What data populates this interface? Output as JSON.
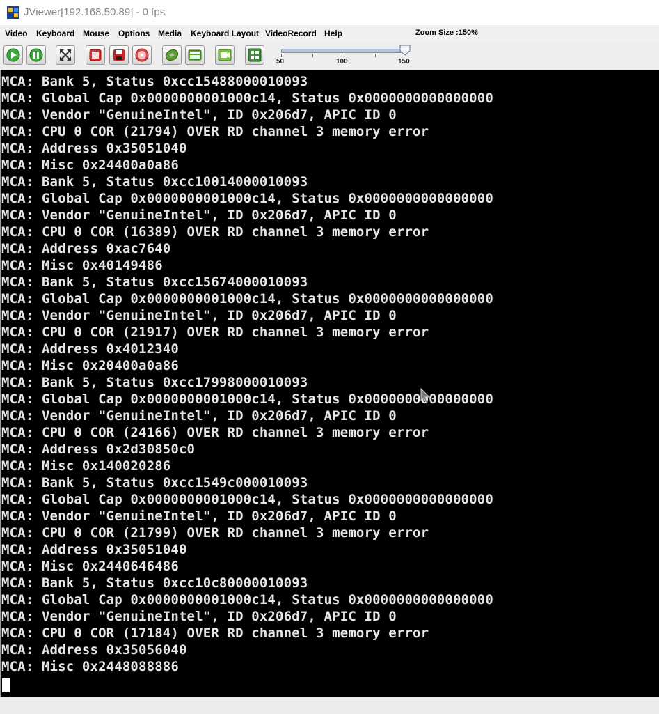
{
  "window": {
    "title": "JViewer[192.168.50.89] - 0 fps"
  },
  "menu": {
    "items": [
      {
        "label": "Video"
      },
      {
        "label": "Keyboard"
      },
      {
        "label": "Mouse"
      },
      {
        "label": "Options"
      },
      {
        "label": "Media"
      },
      {
        "label": "Keyboard Layout"
      },
      {
        "label": "VideoRecord"
      },
      {
        "label": "Help"
      }
    ],
    "zoom_label": "Zoom Size :150%"
  },
  "toolbar": {
    "buttons": [
      {
        "icon": "play-icon"
      },
      {
        "icon": "pause-icon"
      },
      {
        "icon": "fullscreen-icon"
      },
      {
        "icon": "stop-record-icon"
      },
      {
        "icon": "save-icon"
      },
      {
        "icon": "cd-icon"
      },
      {
        "icon": "mouse-icon"
      },
      {
        "icon": "keyboard-icon"
      },
      {
        "icon": "video-capture-icon"
      },
      {
        "icon": "hotkeys-icon"
      }
    ],
    "zoom_slider": {
      "min": 50,
      "max": 150,
      "value": 150,
      "labels": [
        "50",
        "100",
        "150"
      ]
    }
  },
  "console": {
    "lines": [
      "MCA: Bank 5, Status 0xcc15488000010093",
      "MCA: Global Cap 0x0000000001000c14, Status 0x0000000000000000",
      "MCA: Vendor \"GenuineIntel\", ID 0x206d7, APIC ID 0",
      "MCA: CPU 0 COR (21794) OVER RD channel 3 memory error",
      "MCA: Address 0x35051040",
      "MCA: Misc 0x24400a0a86",
      "MCA: Bank 5, Status 0xcc10014000010093",
      "MCA: Global Cap 0x0000000001000c14, Status 0x0000000000000000",
      "MCA: Vendor \"GenuineIntel\", ID 0x206d7, APIC ID 0",
      "MCA: CPU 0 COR (16389) OVER RD channel 3 memory error",
      "MCA: Address 0xac7640",
      "MCA: Misc 0x40149486",
      "MCA: Bank 5, Status 0xcc15674000010093",
      "MCA: Global Cap 0x0000000001000c14, Status 0x0000000000000000",
      "MCA: Vendor \"GenuineIntel\", ID 0x206d7, APIC ID 0",
      "MCA: CPU 0 COR (21917) OVER RD channel 3 memory error",
      "MCA: Address 0x4012340",
      "MCA: Misc 0x20400a0a86",
      "MCA: Bank 5, Status 0xcc17998000010093",
      "MCA: Global Cap 0x0000000001000c14, Status 0x0000000000000000",
      "MCA: Vendor \"GenuineIntel\", ID 0x206d7, APIC ID 0",
      "MCA: CPU 0 COR (24166) OVER RD channel 3 memory error",
      "MCA: Address 0x2d30850c0",
      "MCA: Misc 0x140020286",
      "MCA: Bank 5, Status 0xcc1549c000010093",
      "MCA: Global Cap 0x0000000001000c14, Status 0x0000000000000000",
      "MCA: Vendor \"GenuineIntel\", ID 0x206d7, APIC ID 0",
      "MCA: CPU 0 COR (21799) OVER RD channel 3 memory error",
      "MCA: Address 0x35051040",
      "MCA: Misc 0x2440646486",
      "MCA: Bank 5, Status 0xcc10c80000010093",
      "MCA: Global Cap 0x0000000001000c14, Status 0x0000000000000000",
      "MCA: Vendor \"GenuineIntel\", ID 0x206d7, APIC ID 0",
      "MCA: CPU 0 COR (17184) OVER RD channel 3 memory error",
      "MCA: Address 0x35056040",
      "MCA: Misc 0x2448088886"
    ]
  }
}
